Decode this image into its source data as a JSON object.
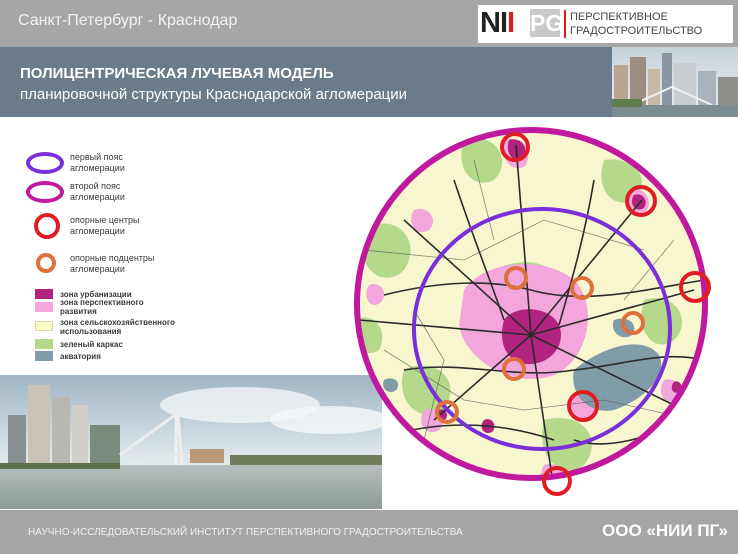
{
  "header": {
    "route": "Санкт-Петербург - Краснодар",
    "logo_mark_ni": "NI",
    "logo_mark_i": "I",
    "logo_mark_pg": "PG",
    "logo_line1": "ПЕРСПЕКТИВНОЕ",
    "logo_line2": "ГРАДОСТРОИТЕЛЬСТВО"
  },
  "title": {
    "line1": "ПОЛИЦЕНТРИЧЕСКАЯ ЛУЧЕВАЯ МОДЕЛЬ",
    "line2": "планировочной структуры Краснодарской агломерации"
  },
  "legend": {
    "rings": [
      {
        "line1": "первый пояс",
        "line2": "агломерации",
        "color": "#7a2fd9"
      },
      {
        "line1": "второй пояс",
        "line2": "агломерации",
        "color": "#c0199e"
      },
      {
        "line1": "опорные центры",
        "line2": "агломерации",
        "color": "#e01d24"
      },
      {
        "line1": "опорные подцентры",
        "line2": "агломерации",
        "color": "#e0703a"
      }
    ],
    "zones": [
      {
        "line1": "зона урбанизации",
        "line2": "",
        "color": "#b2227f"
      },
      {
        "line1": "зона перспективного",
        "line2": "развития",
        "color": "#f2a6dc"
      },
      {
        "line1": "зона сельскохозяйственного",
        "line2": "использования",
        "color": "#fafac8"
      },
      {
        "line1": "зеленый каркас",
        "line2": "",
        "color": "#b5d98a"
      },
      {
        "line1": "акватория",
        "line2": "",
        "color": "#7f9ca8"
      }
    ]
  },
  "footer": {
    "institute": "НАУЧНО-ИССЛЕДОВАТЕЛЬСКИЙ ИНСТИТУТ ПЕРСПЕКТИВНОГО ГРАДОСТРОИТЕЛЬСТВА",
    "company": "ООО «НИИ ПГ»"
  }
}
